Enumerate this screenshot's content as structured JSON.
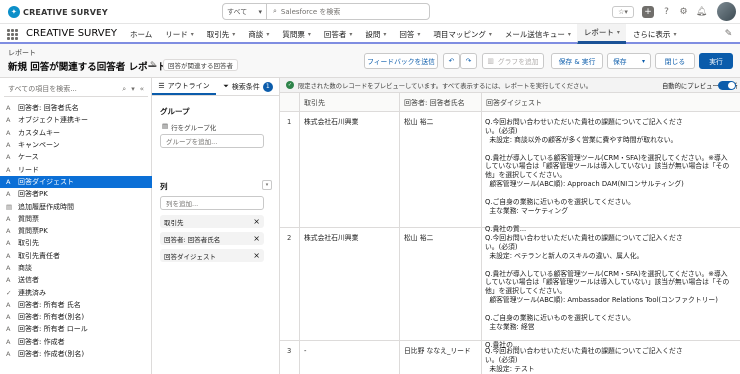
{
  "topbar": {
    "logo_text": "CREATIVE SURVEY",
    "search_scope": "すべて",
    "search_placeholder": "Salesforce を検索"
  },
  "nav": {
    "app_name": "CREATIVE SURVEY",
    "tabs": [
      {
        "label": "ホーム",
        "chevron": false,
        "active": false
      },
      {
        "label": "リード",
        "chevron": true,
        "active": false
      },
      {
        "label": "取引先",
        "chevron": true,
        "active": false
      },
      {
        "label": "商談",
        "chevron": true,
        "active": false
      },
      {
        "label": "質問票",
        "chevron": true,
        "active": false
      },
      {
        "label": "回答者",
        "chevron": true,
        "active": false
      },
      {
        "label": "設問",
        "chevron": true,
        "active": false
      },
      {
        "label": "回答",
        "chevron": true,
        "active": false
      },
      {
        "label": "項目マッピング",
        "chevron": true,
        "active": false
      },
      {
        "label": "メール送信キュー",
        "chevron": true,
        "active": false
      },
      {
        "label": "レポート",
        "chevron": true,
        "active": true
      },
      {
        "label": "さらに表示",
        "chevron": true,
        "active": false
      }
    ]
  },
  "header": {
    "breadcrumb": "レポート",
    "title": "新規 回答が関連する回答者 レポート",
    "report_type": "回答が関連する回答者",
    "feedback": "フィードバックを送信",
    "add_chart": "グラフを追加",
    "save_run": "保存 & 実行",
    "save": "保存",
    "close": "閉じる",
    "run": "実行"
  },
  "fields": {
    "search_placeholder": "すべての項目を検索...",
    "items": [
      {
        "type": "A",
        "label": "回答者: 回答者氏名",
        "selected": false
      },
      {
        "type": "A",
        "label": "オブジェクト連携キー",
        "selected": false
      },
      {
        "type": "A",
        "label": "カスタムキー",
        "selected": false
      },
      {
        "type": "A",
        "label": "キャンペーン",
        "selected": false
      },
      {
        "type": "A",
        "label": "ケース",
        "selected": false
      },
      {
        "type": "A",
        "label": "リード",
        "selected": false
      },
      {
        "type": "A",
        "label": "回答ダイジェスト",
        "selected": true
      },
      {
        "type": "A",
        "label": "回答者PK",
        "selected": false
      },
      {
        "type": "▤",
        "label": "追加履歴作成時間",
        "selected": false
      },
      {
        "type": "A",
        "label": "質問票",
        "selected": false
      },
      {
        "type": "A",
        "label": "質問票PK",
        "selected": false
      },
      {
        "type": "A",
        "label": "取引先",
        "selected": false
      },
      {
        "type": "A",
        "label": "取引先責任者",
        "selected": false
      },
      {
        "type": "A",
        "label": "商談",
        "selected": false
      },
      {
        "type": "A",
        "label": "送信者",
        "selected": false
      },
      {
        "type": "✓",
        "label": "連携済み",
        "selected": false
      },
      {
        "type": "A",
        "label": "回答者: 所有者 氏名",
        "selected": false
      },
      {
        "type": "A",
        "label": "回答者: 所有者(別名)",
        "selected": false
      },
      {
        "type": "A",
        "label": "回答者: 所有者 ロール",
        "selected": false
      },
      {
        "type": "A",
        "label": "回答者: 作成者",
        "selected": false
      },
      {
        "type": "A",
        "label": "回答者: 作成者(別名)",
        "selected": false
      }
    ]
  },
  "builder": {
    "tab_outline": "アウトライン",
    "tab_filters": "検索条件",
    "filter_count": "1",
    "group_heading": "グループ",
    "group_rows_label": "行をグループ化",
    "group_placeholder": "グループを追加...",
    "columns_heading": "列",
    "column_placeholder": "列を追加...",
    "columns": [
      "取引先",
      "回答者: 回答者氏名",
      "回答ダイジェスト"
    ]
  },
  "preview": {
    "notice": "限定された数のレコードをプレビューしています。すべて表示するには、レポートを実行してください。",
    "auto_preview": "自動的にプレビューを更新",
    "col_account": "取引先",
    "col_name": "回答者: 回答者氏名",
    "col_digest": "回答ダイジェスト",
    "rows": [
      {
        "num": "1",
        "account": "株式会社石川興業",
        "name": "松山 裕二",
        "lines": [
          "Q.今回お問い合わせいただいた貴社の課題についてご記入くださ",
          "い。(必須)",
          "  未設定: 商談以外の顧客が多く営業に費やす時間が取れない。",
          "",
          "Q.貴社が導入している顧客管理ツール(CRM・SFA)を選択してください。※導入",
          "していない場合は「顧客管理ツールは導入していない」該当が無い場合は「その",
          "他」を選択してください。",
          "  顧客管理ツール(ABC順): Approach DAM(NIコンサルティング)",
          "",
          "Q.ご自身の業務に近いものを選択してください。",
          "  主な業務: マーケティング",
          "",
          "Q.貴社の質..."
        ]
      },
      {
        "num": "2",
        "account": "株式会社石川興業",
        "name": "松山 裕二",
        "lines": [
          "Q.今回お問い合わせいただいた貴社の課題についてご記入くださ",
          "い。(必須)",
          "  未設定: ベテランと新人のスキルの違い、属人化。",
          "",
          "Q.貴社が導入している顧客管理ツール(CRM・SFA)を選択してください。※導入",
          "していない場合は「顧客管理ツールは導入していない」該当が無い場合は「その",
          "他」を選択してください。",
          "  顧客管理ツール(ABC順): Ambassador Relations Tool(コンファクトリー)",
          "",
          "Q.ご自身の業務に近いものを選択してください。",
          "  主な業務: 経営",
          "",
          "Q.貴社の..."
        ]
      },
      {
        "num": "3",
        "account": "-",
        "name": "日比野 ななえ_リード",
        "lines": [
          "Q.今回お問い合わせいただいた貴社の課題についてご記入くださ",
          "い。(必須)",
          "  未設定: テスト"
        ]
      }
    ]
  }
}
